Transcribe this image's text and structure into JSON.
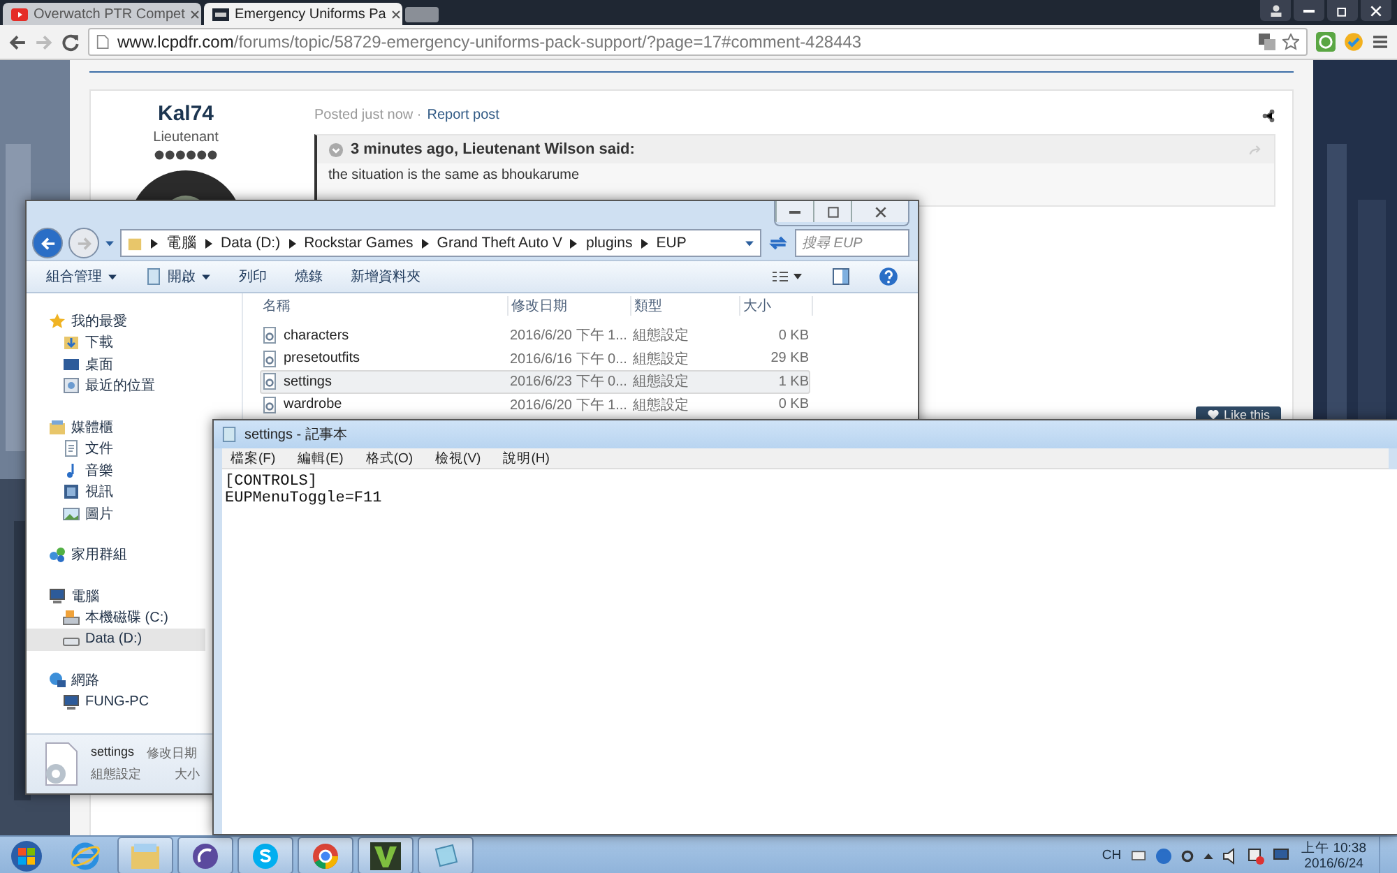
{
  "browser": {
    "tabs": [
      {
        "label": "Overwatch PTR Compet",
        "kind": "video",
        "selected": false
      },
      {
        "label": "Emergency Uniforms Pa",
        "kind": "site",
        "selected": true
      }
    ],
    "url_host": "www.lcpdfr.com",
    "url_path": "/forums/topic/58729-emergency-uniforms-pack-support/?page=17#comment-428443"
  },
  "post": {
    "author": "Kal74",
    "rank": "Lieutenant",
    "posted": "Posted just now ·",
    "report": "Report post",
    "quote_header": "3 minutes ago, Lieutenant Wilson said:",
    "quote_body": "the situation is the same as bhoukarume",
    "like": "Like this"
  },
  "explorer": {
    "breadcrumb": [
      "電腦",
      "Data (D:)",
      "Rockstar Games",
      "Grand Theft Auto V",
      "plugins",
      "EUP"
    ],
    "search": {
      "placeholder": "搜尋 EUP"
    },
    "toolbar": [
      {
        "label": "組合管理",
        "menu": true,
        "kind": "text"
      },
      {
        "label": "開啟",
        "menu": true,
        "kind": "open"
      },
      {
        "label": "列印",
        "menu": false,
        "kind": "text"
      },
      {
        "label": "燒錄",
        "menu": false,
        "kind": "text"
      },
      {
        "label": "新增資料夾",
        "menu": false,
        "kind": "text"
      }
    ],
    "sidebar": [
      {
        "label": "我的最愛",
        "kind": "star",
        "selected": false,
        "children": [
          {
            "label": "下載",
            "kind": "download",
            "selected": false
          },
          {
            "label": "桌面",
            "kind": "desktop",
            "selected": false
          },
          {
            "label": "最近的位置",
            "kind": "recent",
            "selected": false
          }
        ]
      },
      {
        "label": "媒體櫃",
        "kind": "library",
        "selected": false,
        "children": [
          {
            "label": "文件",
            "kind": "doc",
            "selected": false
          },
          {
            "label": "音樂",
            "kind": "music",
            "selected": false
          },
          {
            "label": "視訊",
            "kind": "video",
            "selected": false
          },
          {
            "label": "圖片",
            "selected": false
          }
        ]
      },
      {
        "label": "家用群組",
        "kind": "homegroup",
        "selected": false
      },
      {
        "label": "電腦",
        "kind": "computer",
        "selected": false,
        "children": [
          {
            "label": "本機磁碟 (C:)",
            "kind": "sysdrive",
            "selected": false
          },
          {
            "label": "Data (D:)",
            "kind": "drive",
            "selected": true
          }
        ]
      },
      {
        "label": "網路",
        "kind": "network",
        "selected": false,
        "children": [
          {
            "label": "FUNG-PC",
            "kind": "computer",
            "selected": false
          }
        ]
      }
    ],
    "columns": [
      "名稱",
      "修改日期",
      "類型",
      "大小"
    ],
    "files": [
      {
        "name": "characters",
        "date": "2016/6/20 下午 1...",
        "type": "組態設定",
        "size": "0 KB",
        "selected": false
      },
      {
        "name": "presetoutfits",
        "date": "2016/6/16 下午 0...",
        "type": "組態設定",
        "size": "29 KB",
        "selected": false
      },
      {
        "name": "settings",
        "date": "2016/6/23 下午 0...",
        "type": "組態設定",
        "size": "1 KB",
        "selected": true
      },
      {
        "name": "wardrobe",
        "date": "2016/6/20 下午 1...",
        "type": "組態設定",
        "size": "0 KB",
        "selected": false
      }
    ],
    "details": {
      "name": "settings",
      "modified_label": "修改日期",
      "type": "組態設定",
      "size_label": "大小"
    }
  },
  "notepad": {
    "title": "settings - 記事本",
    "menu": [
      "檔案(F)",
      "編輯(E)",
      "格式(O)",
      "檢視(V)",
      "說明(H)"
    ],
    "lines": [
      "[CONTROLS]",
      "EUPMenuToggle=F11"
    ]
  },
  "taskbar": {
    "apps": [
      {
        "kind": "ie",
        "active": false
      },
      {
        "kind": "folder",
        "active": true
      },
      {
        "kind": "torrent",
        "active": true
      },
      {
        "kind": "skype",
        "active": true
      },
      {
        "kind": "chrome",
        "active": true
      },
      {
        "kind": "v",
        "active": true
      },
      {
        "kind": "notepad",
        "active": true
      }
    ],
    "language": "CH",
    "time": "上午 10:38",
    "date": "2016/6/24"
  }
}
